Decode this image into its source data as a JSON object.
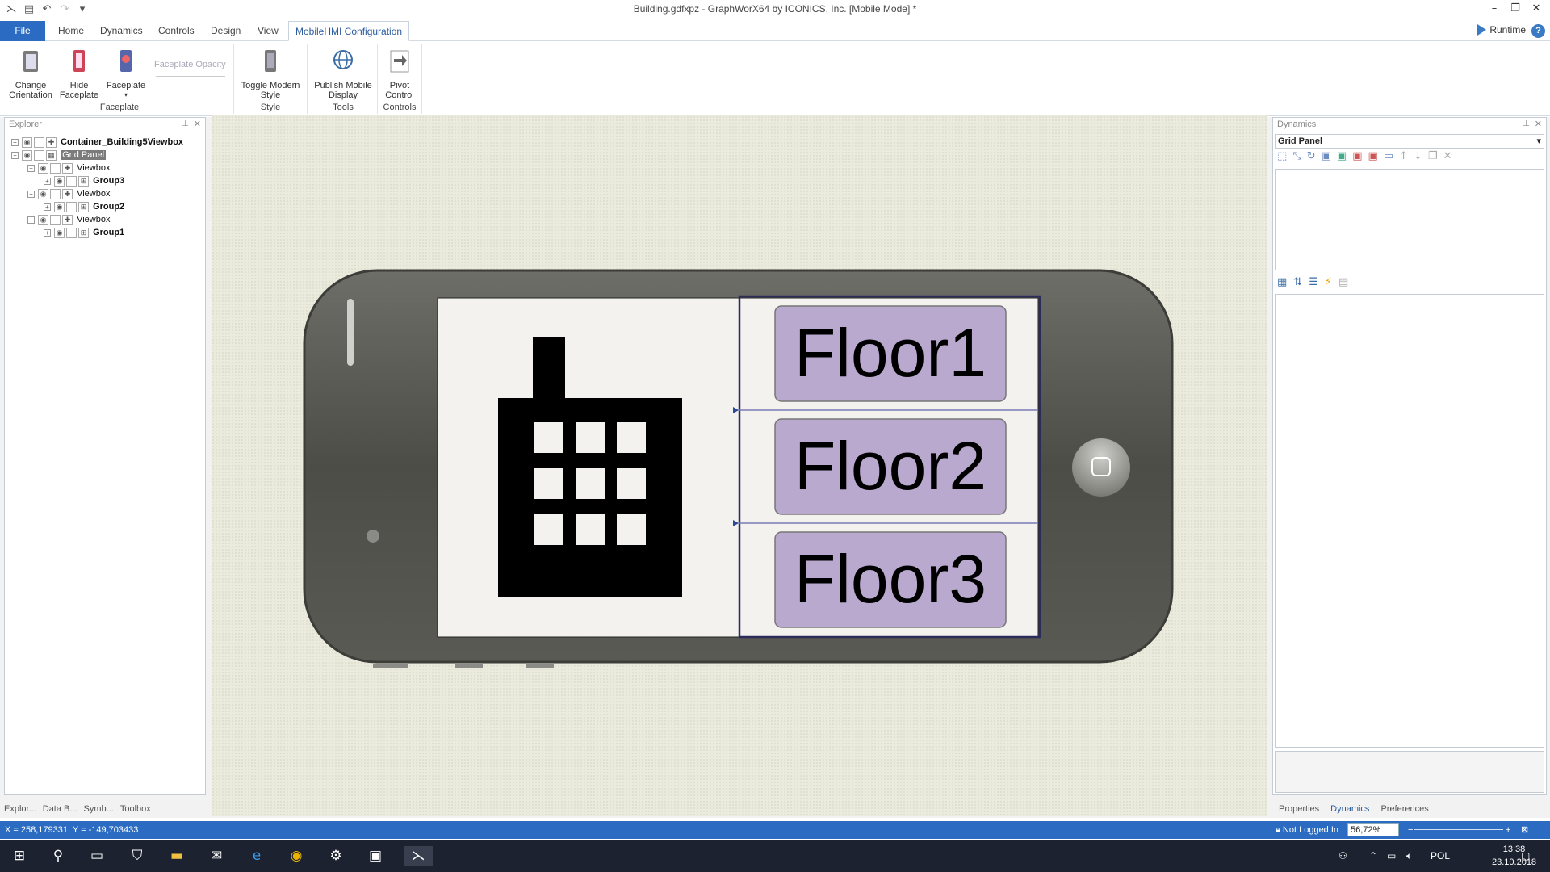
{
  "window": {
    "title": "Building.gdfxpz - GraphWorX64 by ICONICS, Inc. [Mobile Mode] *"
  },
  "tabs": [
    "File",
    "Home",
    "Dynamics",
    "Controls",
    "Design",
    "View",
    "MobileHMI Configuration"
  ],
  "runtime_label": "Runtime",
  "ribbon": {
    "change_orientation": "Change\nOrientation",
    "hide_faceplate": "Hide\nFaceplate",
    "faceplate": "Faceplate",
    "faceplate_opacity": "Faceplate Opacity",
    "toggle_modern_style": "Toggle Modern\nStyle",
    "publish_mobile_display": "Publish Mobile\nDisplay",
    "pivot_control": "Pivot\nControl",
    "groups": {
      "faceplate": "Faceplate",
      "style": "Style",
      "tools": "Tools",
      "controls": "Controls"
    }
  },
  "explorer": {
    "title": "Explorer",
    "tree": [
      {
        "label": "Container_Building5Viewbox",
        "bold": true
      },
      {
        "label": "Grid Panel",
        "selected": true
      },
      {
        "label": "Viewbox"
      },
      {
        "label": "Group3",
        "bold": true
      },
      {
        "label": "Viewbox"
      },
      {
        "label": "Group2",
        "bold": true
      },
      {
        "label": "Viewbox"
      },
      {
        "label": "Group1",
        "bold": true
      }
    ],
    "bottom_tabs": [
      "Explor...",
      "Data B...",
      "Symb...",
      "Toolbox"
    ]
  },
  "dynamics_panel": {
    "title": "Dynamics",
    "selected": "Grid Panel",
    "bottom_tabs": [
      "Properties",
      "Dynamics",
      "Preferences"
    ]
  },
  "canvas": {
    "floors": [
      "Floor1",
      "Floor2",
      "Floor3"
    ],
    "colors": {
      "floor_button": "#b9a9cf",
      "phone_body": "#5a5a54",
      "screen": "#f3f2ef",
      "building": "#000000"
    }
  },
  "status": {
    "coords": "X = 258,179331, Y = -149,703433",
    "login": "Not Logged In",
    "zoom": "56,72%"
  },
  "taskbar": {
    "lang": "POL",
    "time": "13:38",
    "date": "23.10.2018"
  }
}
